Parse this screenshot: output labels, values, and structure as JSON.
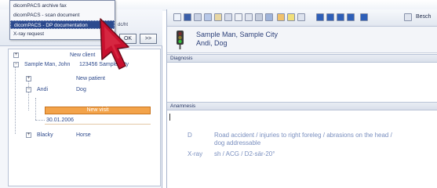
{
  "menu": {
    "items": [
      {
        "label": "dicomPACS archive fax"
      },
      {
        "label": "dicomPACS - scan document"
      },
      {
        "label": "dicomPACS - DP documentation"
      },
      {
        "label": "X-ray request"
      }
    ],
    "selected_index": 2
  },
  "left": {
    "header_text": "dc/ht",
    "ok_label": "OK",
    "next_label": ">>",
    "tree": {
      "new_client": "New client",
      "client_name": "Sample Man, John",
      "client_address": "123456 Sample City",
      "new_patient": "New patient",
      "patient_name": "Andi",
      "patient_species": "Dog",
      "new_visit": "New visit",
      "visit_date": "30.01.2006",
      "patient2_name": "Blacky",
      "patient2_species": "Horse"
    }
  },
  "right": {
    "toolbar_describe": "Besch",
    "patient_header": {
      "name_city": "Sample Man, Sample City",
      "pet": "Andi, Dog"
    },
    "diagnosis_label": "Diagnosis",
    "anamnesis_label": "Anamnesis",
    "anamnesis_entries": [
      {
        "code": "D",
        "text_line1": "Road accident / injuries to right foreleg / abrasions on the head /",
        "text_line2": "dog addressable"
      },
      {
        "code": "X-ray",
        "text_line1": "sh / ACG / D2-sär-20°",
        "text_line2": ""
      }
    ]
  },
  "colors": {
    "accent_selected": "#2c4a8e",
    "visit_orange": "#f3a34a",
    "cursor_red": "#c8102e"
  }
}
